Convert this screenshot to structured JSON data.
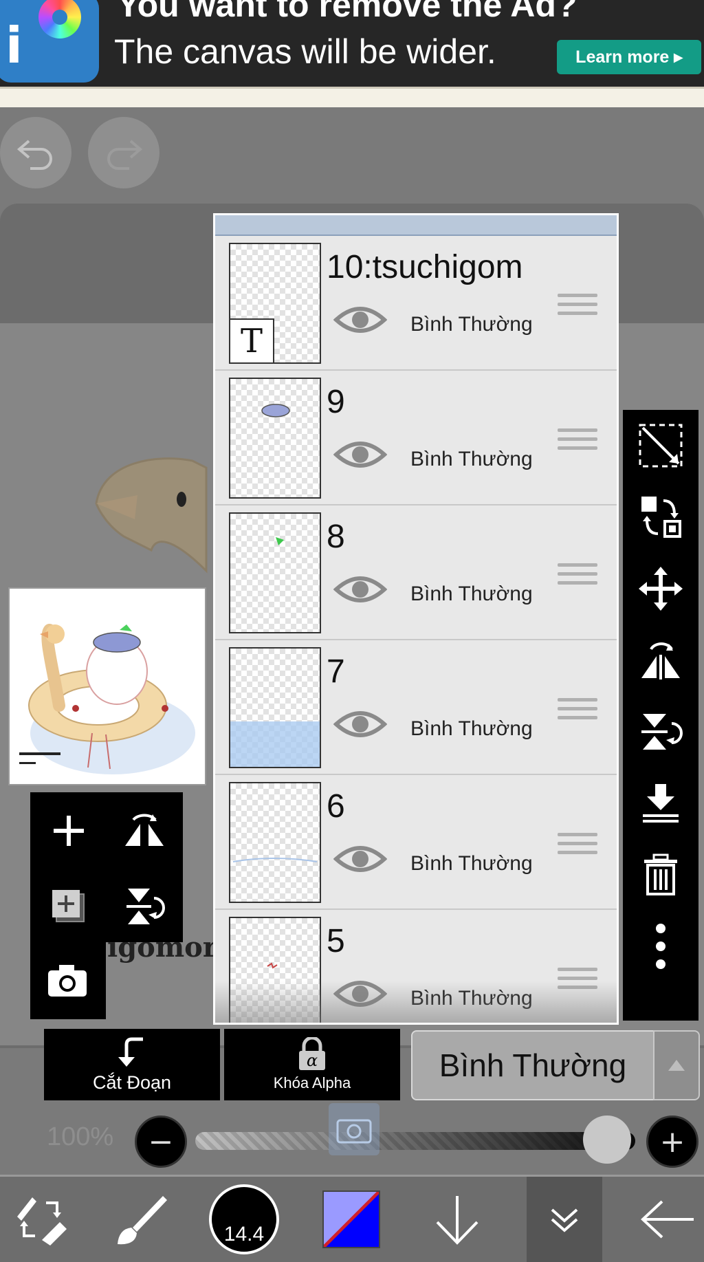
{
  "ad": {
    "title": "You want to remove the Ad?",
    "subtitle": "The canvas will be wider.",
    "button": "Learn more ▸",
    "logo_icon": "ibispaint-logo"
  },
  "history": {
    "undo_icon": "undo-icon",
    "redo_icon": "redo-icon"
  },
  "canvas": {
    "background_text": "igomori"
  },
  "layers": [
    {
      "name": "10:tsuchigom",
      "blend": "Bình Thường",
      "visible": true
    },
    {
      "name": "9",
      "blend": "Bình Thường",
      "visible": true
    },
    {
      "name": "8",
      "blend": "Bình Thường",
      "visible": true
    },
    {
      "name": "7",
      "blend": "Bình Thường",
      "visible": true
    },
    {
      "name": "6",
      "blend": "Bình Thường",
      "visible": true
    },
    {
      "name": "5",
      "blend": "Bình Thường",
      "visible": true
    }
  ],
  "layer_thumb_text": "T",
  "controls": {
    "clip_label": "Cắt Đoạn",
    "alpha_label": "Khóa Alpha",
    "blend_mode": "Bình Thường",
    "opacity_label": "100%",
    "opacity_value": 1.0
  },
  "bottombar": {
    "brush_size": "14.4",
    "colors": {
      "primary": "#0000ff",
      "secondary": "#9a9aff"
    }
  }
}
